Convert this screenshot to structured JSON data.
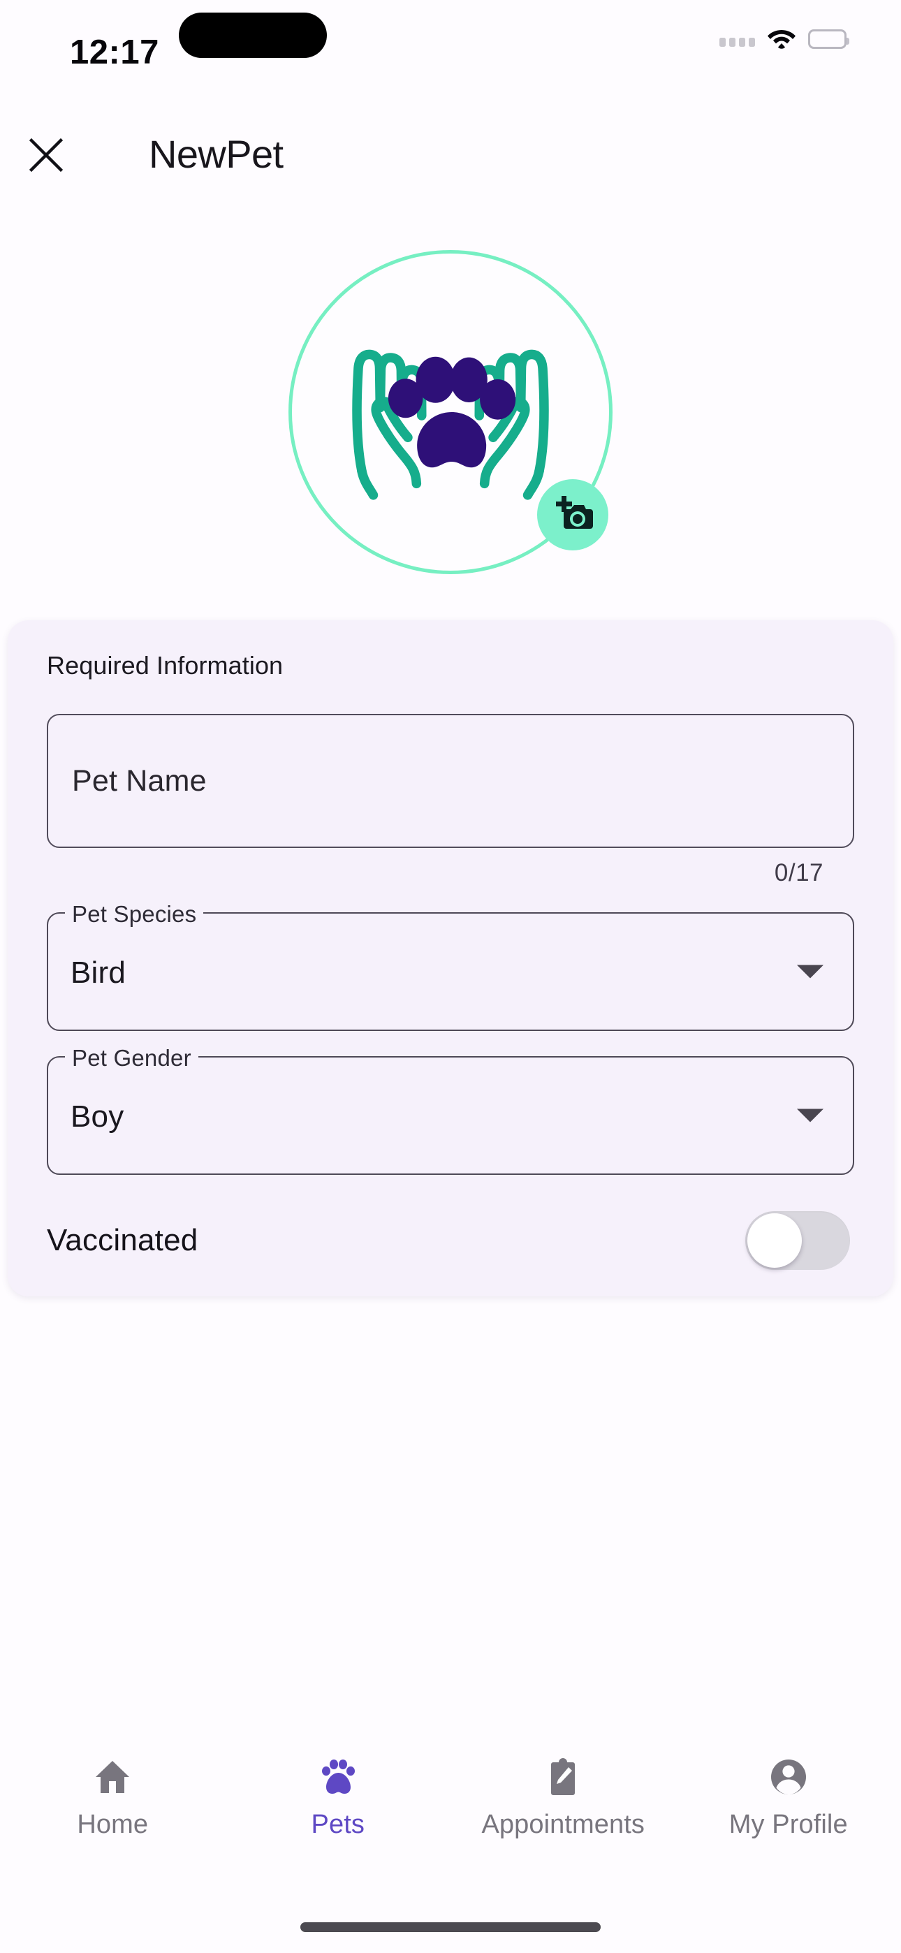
{
  "status_bar": {
    "time": "12:17",
    "icons": [
      "cellular-dots-icon",
      "wifi-icon",
      "battery-icon"
    ]
  },
  "header": {
    "close_icon": "close-icon",
    "title": "NewPet"
  },
  "avatar": {
    "logo_icon": "hands-holding-paw-logo",
    "ring_color": "#76EFC2",
    "hands_color": "#16AD8C",
    "paw_color": "#2E1078",
    "camera_badge": {
      "icon": "add-photo-camera-icon",
      "background": "#7CF0CB",
      "glyph_color": "#0B2220"
    }
  },
  "form": {
    "section_label": "Required Information",
    "card_background": "#F6F1FB",
    "pet_name": {
      "label": "Pet Name",
      "value": "",
      "placeholder": "Pet Name",
      "counter": "0/17",
      "max_length": 17
    },
    "pet_species": {
      "label": "Pet Species",
      "value": "Bird",
      "caret_icon": "chevron-down-icon"
    },
    "pet_gender": {
      "label": "Pet Gender",
      "value": "Boy",
      "caret_icon": "chevron-down-icon"
    },
    "vaccinated": {
      "label": "Vaccinated",
      "state": "off"
    }
  },
  "bottom_nav": {
    "active_color": "#5E48C4",
    "inactive_color": "#78757E",
    "items": [
      {
        "label": "Home",
        "icon": "home-icon",
        "active": false
      },
      {
        "label": "Pets",
        "icon": "paw-icon",
        "active": true
      },
      {
        "label": "Appointments",
        "icon": "clipboard-pen-icon",
        "active": false
      },
      {
        "label": "My Profile",
        "icon": "person-circle-icon",
        "active": false
      }
    ]
  }
}
